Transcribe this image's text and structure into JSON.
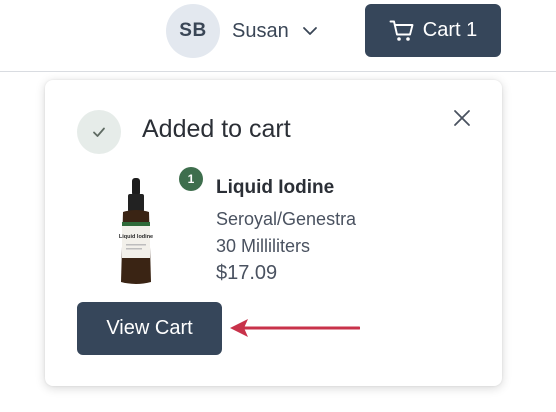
{
  "header": {
    "user": {
      "initials": "SB",
      "name": "Susan",
      "menu_icon": "chevron-down-icon"
    },
    "cart_button": {
      "label": "Cart 1",
      "icon": "cart-icon"
    }
  },
  "popover": {
    "title": "Added to cart",
    "status_icon": "check-icon",
    "close_icon": "close-icon",
    "item": {
      "quantity": "1",
      "name": "Liquid Iodine",
      "brand": "Seroyal/Genestra",
      "size": "30 Milliliters",
      "price": "$17.09",
      "image_label": "Liquid Iodine"
    },
    "view_cart_label": "View Cart"
  },
  "annotation": {
    "arrow_color": "#c8324a"
  },
  "colors": {
    "primary": "#36465a",
    "badge": "#3e6e4d",
    "avatar_bg": "#e3e8ef"
  }
}
